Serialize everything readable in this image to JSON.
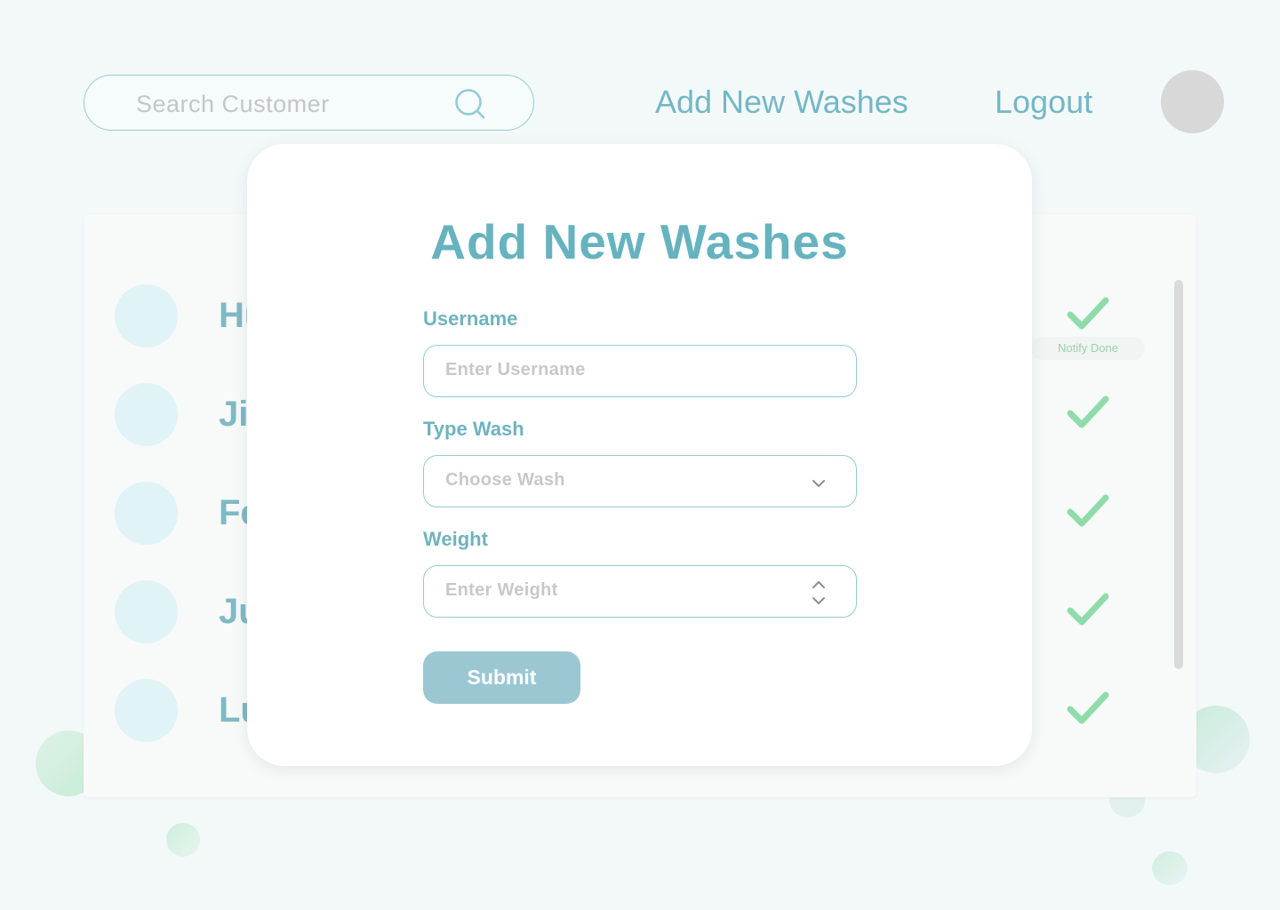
{
  "header": {
    "search_placeholder": "Search Customer",
    "nav_add_label": "Add New Washes",
    "nav_logout_label": "Logout"
  },
  "list": {
    "rows": [
      {
        "name": "Hu"
      },
      {
        "name": "Ji"
      },
      {
        "name": "Fe"
      },
      {
        "name": "Ju"
      },
      {
        "name": "Lu"
      }
    ],
    "notify_label": "Notify Done"
  },
  "modal": {
    "title": "Add New Washes",
    "username_label": "Username",
    "username_placeholder": "Enter Username",
    "type_label": "Type Wash",
    "type_placeholder": "Choose Wash",
    "weight_label": "Weight",
    "weight_placeholder": "Enter Weight",
    "submit_label": "Submit"
  },
  "colors": {
    "accent": "#66b3bf",
    "border": "#93cad6",
    "check": "#8fdcaa",
    "submit": "#9bc7d3",
    "background": "#f3f9f9"
  },
  "icons": {
    "search": "search-icon",
    "check": "check-icon",
    "dropdown": "chevron-down-icon",
    "stepper": "stepper-icon"
  }
}
